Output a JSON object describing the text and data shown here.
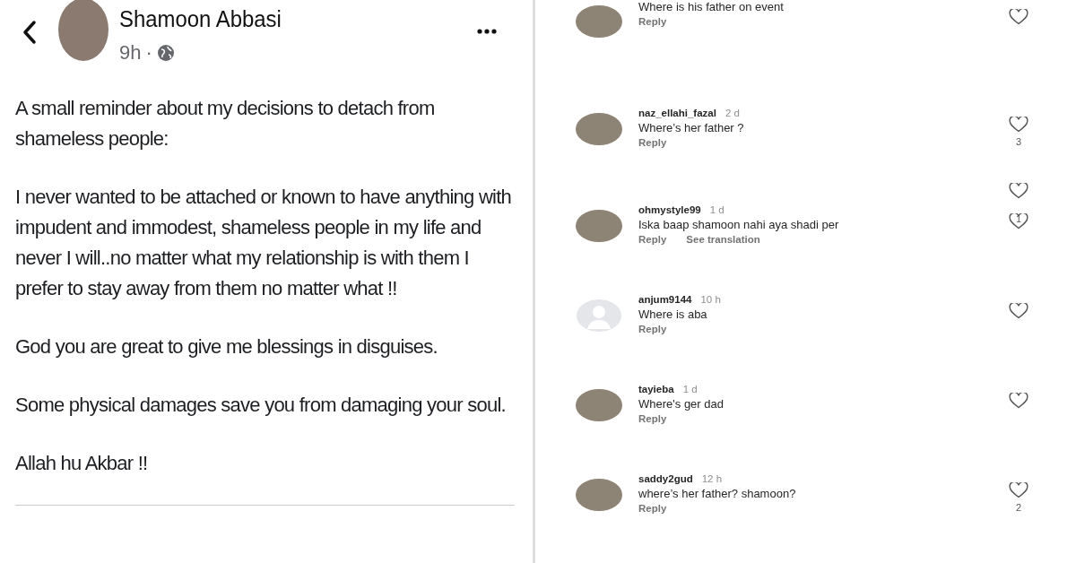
{
  "post": {
    "author": "Shamoon Abbasi",
    "time": "9h",
    "separator": "·",
    "paragraphs": [
      "A small reminder about my decisions to detach from shameless people:",
      "I never wanted to be attached or known to have anything with impudent and immodest, shameless people in my life and never I will..no matter what my relationship is with them I prefer to stay away from them no matter what !!",
      "God you are great to give me blessings in disguises.",
      "Some physical damages save you from damaging your soul.",
      "Allah hu Akbar !!"
    ]
  },
  "comments": [
    {
      "kind": "comment",
      "default_avatar": false,
      "text": "Where is his father on event",
      "actions": [
        "Reply"
      ]
    },
    {
      "kind": "comment",
      "default_avatar": false,
      "user": "naz_ellahi_fazal",
      "age": "2 d",
      "text": "Where’s her father ?",
      "actions": [
        "Reply"
      ],
      "likes": "3"
    },
    {
      "kind": "hidden",
      "likes": "1"
    },
    {
      "kind": "comment",
      "default_avatar": false,
      "user": "ohmystyle99",
      "age": "1 d",
      "text": "Iska baap shamoon nahi aya shadi per",
      "actions": [
        "Reply",
        "See translation"
      ]
    },
    {
      "kind": "comment",
      "default_avatar": true,
      "user": "anjum9144",
      "age": "10 h",
      "text": "Where is aba",
      "actions": [
        "Reply"
      ]
    },
    {
      "kind": "comment",
      "default_avatar": false,
      "user": "tayieba",
      "age": "1 d",
      "text": "Where's ger dad",
      "actions": [
        "Reply"
      ]
    },
    {
      "kind": "comment",
      "default_avatar": false,
      "user": "saddy2gud",
      "age": "12 h",
      "text": "where’s her father? shamoon?",
      "actions": [
        "Reply"
      ],
      "likes": "2"
    }
  ]
}
